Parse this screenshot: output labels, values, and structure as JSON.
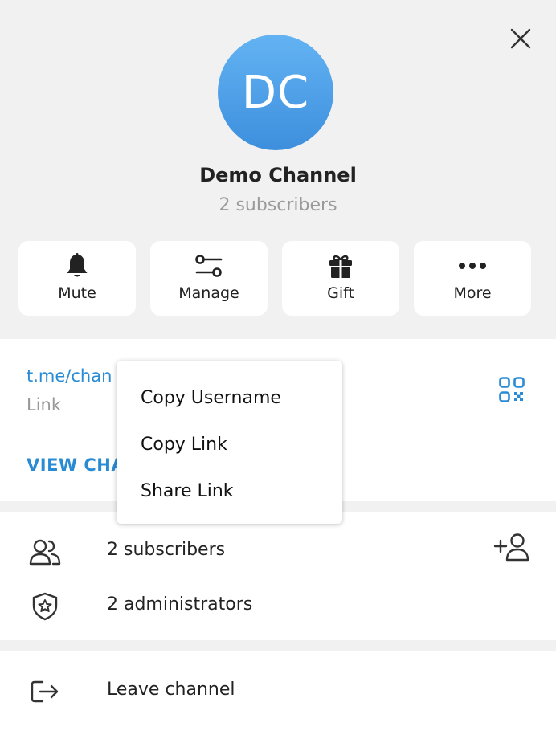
{
  "header": {
    "avatar_initials": "DC",
    "avatar_gradient_top": "#63b3f3",
    "avatar_gradient_bottom": "#3d8fdd",
    "channel_name": "Demo Channel",
    "subscribers_text": "2 subscribers",
    "close_icon": "close-icon"
  },
  "actions": [
    {
      "label": "Mute",
      "icon": "bell-icon"
    },
    {
      "label": "Manage",
      "icon": "sliders-icon"
    },
    {
      "label": "Gift",
      "icon": "gift-icon"
    },
    {
      "label": "More",
      "icon": "more-dots-icon"
    }
  ],
  "info": {
    "link_text": "t.me/chan",
    "link_label": "Link",
    "view_button": "VIEW CHA",
    "qr_icon": "qr-code-icon",
    "accent_color": "#2a8bd5"
  },
  "members": {
    "subscribers": "2 subscribers",
    "administrators": "2 administrators",
    "add_icon": "add-user-icon"
  },
  "leave": {
    "label": "Leave channel",
    "icon": "exit-icon"
  },
  "context_menu": {
    "items": [
      "Copy Username",
      "Copy Link",
      "Share Link"
    ]
  }
}
